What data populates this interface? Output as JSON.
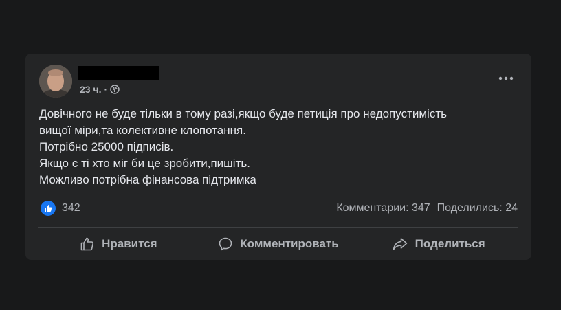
{
  "post": {
    "timestamp": "23 ч.",
    "separator": "·",
    "privacy_icon": "globe-icon",
    "more_icon": "more-options-icon",
    "text_lines": [
      "Довічного не буде тільки в тому разі,якщо буде петиція про недопустимість",
      "вищої міри,та колективне клопотання.",
      "Потрібно 25000 підписів.",
      "Якщо є ті хто міг би це зробити,пишіть.",
      "Можливо потрібна фінансова підтримка"
    ],
    "reaction_icon": "like-reaction-icon",
    "reaction_count": "342",
    "comments_label": "Комментарии: 347",
    "shares_label": "Поделились: 24"
  },
  "actions": {
    "like_label": "Нравится",
    "comment_label": "Комментировать",
    "share_label": "Поделиться"
  },
  "colors": {
    "page_background": "#18191a",
    "card_background": "#242526",
    "primary_text": "#e4e6eb",
    "secondary_text": "#b0b3b8",
    "like_blue": "#1877f2"
  }
}
